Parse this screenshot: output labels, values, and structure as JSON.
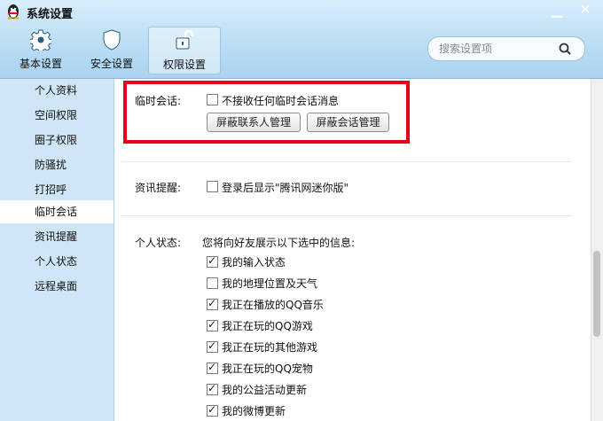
{
  "window": {
    "title": "系统设置",
    "minimize_glyph": "▁",
    "close_glyph": "✕"
  },
  "top_tabs": [
    {
      "label": "基本设置",
      "icon": "gear-icon"
    },
    {
      "label": "安全设置",
      "icon": "shield-icon"
    },
    {
      "label": "权限设置",
      "icon": "unlock-icon",
      "active": true
    }
  ],
  "search": {
    "placeholder": "搜索设置项",
    "icon": "search-icon"
  },
  "sidebar": {
    "items": [
      {
        "label": "个人资料"
      },
      {
        "label": "空间权限"
      },
      {
        "label": "圈子权限"
      },
      {
        "label": "防骚扰"
      },
      {
        "label": "打招呼"
      },
      {
        "label": "临时会话",
        "active": true
      },
      {
        "label": "资讯提醒"
      },
      {
        "label": "个人状态"
      },
      {
        "label": "远程桌面"
      }
    ]
  },
  "temp_chat": {
    "label": "临时会话:",
    "checkbox_label": "不接收任何临时会话消息",
    "checked": false,
    "buttons": [
      "屏蔽联系人管理",
      "屏蔽会话管理"
    ]
  },
  "news": {
    "label": "资讯提醒:",
    "checkbox_label": "登录后显示\"腾讯网迷你版\"",
    "checked": false
  },
  "status": {
    "label": "个人状态:",
    "intro": "您将向好友展示以下选中的信息:",
    "options": [
      {
        "label": "我的输入状态",
        "checked": true
      },
      {
        "label": "我的地理位置及天气",
        "checked": false
      },
      {
        "label": "我正在播放的QQ音乐",
        "checked": true
      },
      {
        "label": "我正在玩的QQ游戏",
        "checked": true
      },
      {
        "label": "我正在玩的其他游戏",
        "checked": true
      },
      {
        "label": "我正在玩的QQ宠物",
        "checked": true
      },
      {
        "label": "我的公益活动更新",
        "checked": true
      },
      {
        "label": "我的微博更新",
        "checked": true
      }
    ]
  },
  "colors": {
    "highlight_border": "#e8001c",
    "header_bg": "#bfe0f5",
    "sidebar_bg": "#cfe6f6"
  }
}
